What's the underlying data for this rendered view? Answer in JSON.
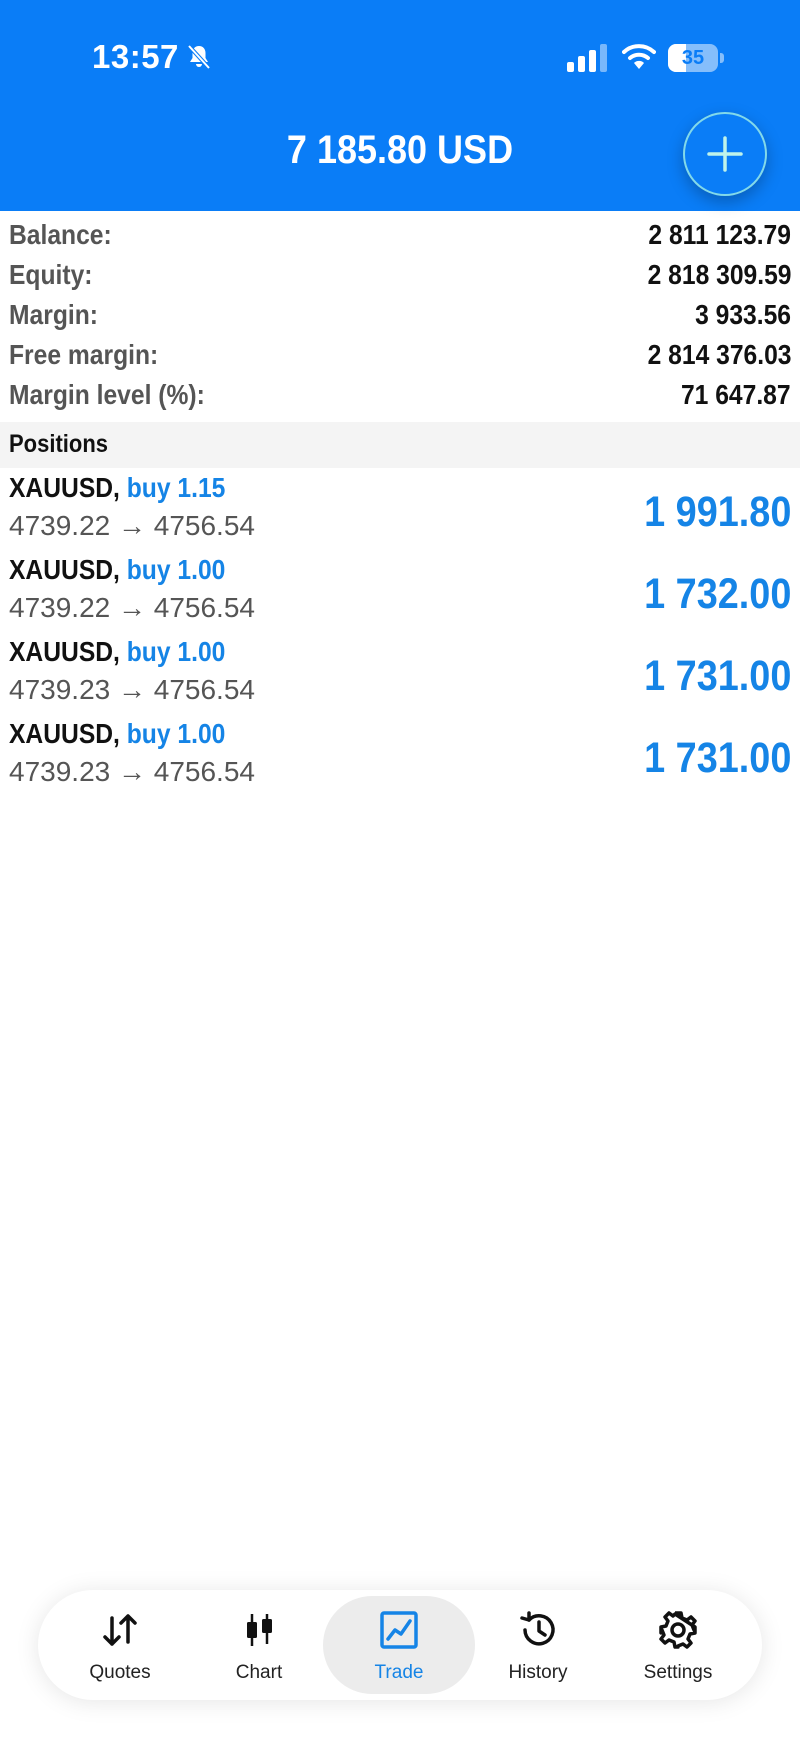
{
  "status_bar": {
    "time": "13:57",
    "battery": "35",
    "battery_level": 0.35
  },
  "header": {
    "title": "7 185.80 USD",
    "add_icon": "plus-icon"
  },
  "account": [
    {
      "label": "Balance:",
      "value": "2 811 123.79"
    },
    {
      "label": "Equity:",
      "value": "2 818 309.59"
    },
    {
      "label": "Margin:",
      "value": "3 933.56"
    },
    {
      "label": "Free margin:",
      "value": "2 814 376.03"
    },
    {
      "label": "Margin level (%):",
      "value": "71 647.87"
    }
  ],
  "positions_title": "Positions",
  "positions": [
    {
      "symbol": "XAUUSD,",
      "side": "buy 1.15",
      "prices": "4739.22 → 4756.54",
      "profit": "1 991.80"
    },
    {
      "symbol": "XAUUSD,",
      "side": "buy 1.00",
      "prices": "4739.22 → 4756.54",
      "profit": "1 732.00"
    },
    {
      "symbol": "XAUUSD,",
      "side": "buy 1.00",
      "prices": "4739.23 → 4756.54",
      "profit": "1 731.00"
    },
    {
      "symbol": "XAUUSD,",
      "side": "buy 1.00",
      "prices": "4739.23 → 4756.54",
      "profit": "1 731.00"
    }
  ],
  "tabs": [
    {
      "label": "Quotes",
      "icon": "quotes-arrows-icon"
    },
    {
      "label": "Chart",
      "icon": "candlestick-chart-icon"
    },
    {
      "label": "Trade",
      "icon": "trade-chart-icon",
      "active": true
    },
    {
      "label": "History",
      "icon": "history-clock-icon"
    },
    {
      "label": "Settings",
      "icon": "gear-icon"
    }
  ],
  "colors": {
    "header": "#0a7df7",
    "accent": "#1584e6"
  }
}
